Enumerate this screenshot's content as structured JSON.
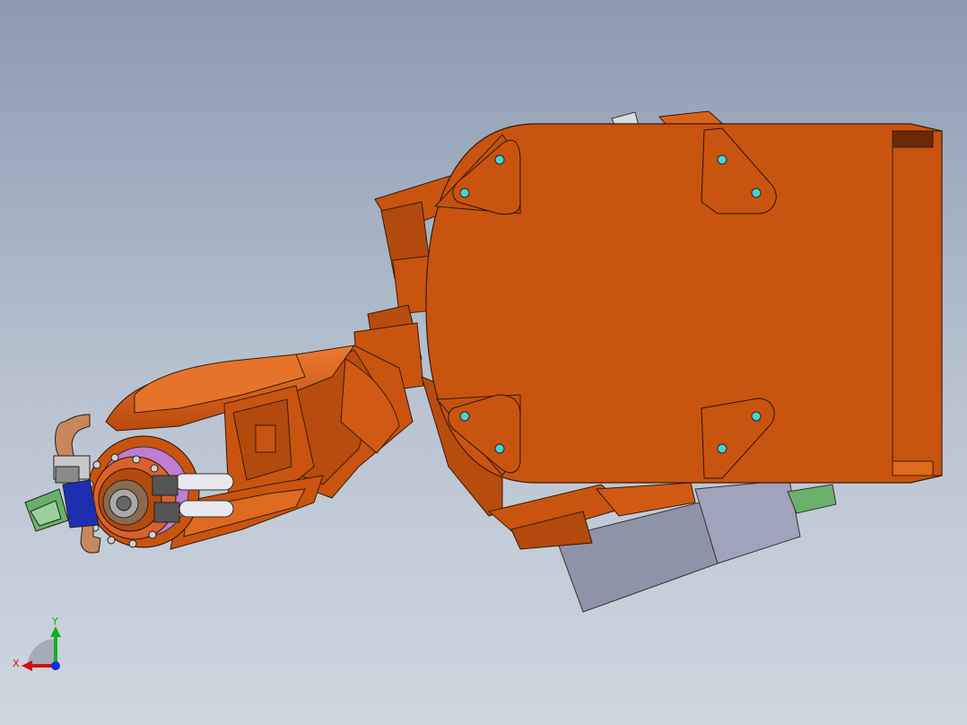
{
  "triad": {
    "x_label": "X",
    "y_label": "Y",
    "x_color": "#d01010",
    "y_color": "#10b020",
    "z_color": "#1030d0"
  },
  "colors": {
    "robot_orange": "#c95410",
    "robot_orange_light": "#e0691c",
    "robot_orange_dark": "#7a2e05",
    "edge": "#3a1a05",
    "bolt": "#4fd0d0",
    "cabinet": "#8e93a8",
    "cabinet_light": "#9fa3bb",
    "tool_blue": "#1d2fb0",
    "tool_green": "#6ab06a",
    "ring_purple": "#c07ed0",
    "pipe_copper": "#c8875a"
  }
}
